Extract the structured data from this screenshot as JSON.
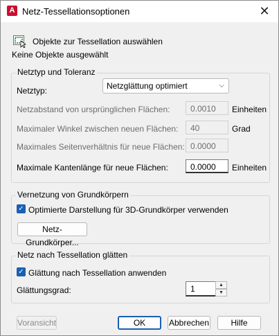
{
  "window": {
    "title": "Netz-Tessellationsoptionen",
    "app_icon_letter": "A",
    "close_glyph": "✕"
  },
  "select_objects": {
    "button_label": "Objekte zur Tessellation auswählen",
    "status": "Keine Objekte ausgewählt",
    "icon": "select-objects-icon"
  },
  "mesh_type": {
    "group_title": "Netztyp und Toleranz",
    "type_label": "Netztyp:",
    "type_value": "Netzglättung optimiert",
    "distance_label": "Netzabstand von ursprünglichen Flächen:",
    "distance_value": "0.0010",
    "distance_unit": "Einheiten",
    "angle_label": "Maximaler Winkel zwischen neuen Flächen:",
    "angle_value": "40",
    "angle_unit": "Grad",
    "ratio_label": "Maximales Seitenverhältnis für neue Flächen:",
    "ratio_value": "0.0000",
    "edge_label": "Maximale Kantenlänge für neue Flächen:",
    "edge_value": "0.0000",
    "edge_unit": "Einheiten"
  },
  "primitives": {
    "group_title": "Vernetzung von Grundkörpern",
    "optimize_label": "Optimierte Darstellung für 3D-Grundkörper verwenden",
    "optimize_checked": true,
    "button_label": "Netz-Grundkörper..."
  },
  "smoothing": {
    "group_title": "Netz nach Tessellation glätten",
    "apply_label": "Glättung nach Tessellation anwenden",
    "apply_checked": true,
    "degree_label": "Glättungsgrad:",
    "degree_value": "1"
  },
  "footer": {
    "preview_label": "Voransicht",
    "ok_label": "OK",
    "cancel_label": "Abbrechen",
    "help_label": "Hilfe"
  },
  "colors": {
    "accent": "#1a5fb4",
    "app_icon": "#c8102e"
  }
}
